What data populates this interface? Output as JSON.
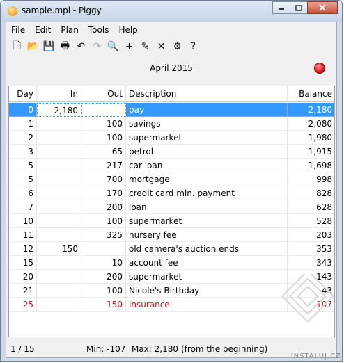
{
  "window": {
    "title": "sample.mpl - Piggy",
    "minimize_icon": "minimize-icon",
    "maximize_icon": "maximize-icon",
    "close_icon": "close-icon"
  },
  "menu": [
    "File",
    "Edit",
    "Plan",
    "Tools",
    "Help"
  ],
  "toolbar": [
    {
      "name": "new-icon",
      "glyph": "🗋",
      "enabled": true
    },
    {
      "name": "open-icon",
      "glyph": "📂",
      "enabled": true
    },
    {
      "name": "save-icon",
      "glyph": "💾",
      "enabled": true
    },
    {
      "name": "print-icon",
      "glyph": "🖶",
      "enabled": true
    },
    {
      "name": "undo-icon",
      "glyph": "↶",
      "enabled": true
    },
    {
      "name": "redo-icon",
      "glyph": "↷",
      "enabled": false
    },
    {
      "name": "search-icon",
      "glyph": "🔍",
      "enabled": true
    },
    {
      "name": "add-icon",
      "glyph": "+",
      "enabled": true
    },
    {
      "name": "edit-icon",
      "glyph": "✎",
      "enabled": true
    },
    {
      "name": "delete-icon",
      "glyph": "✕",
      "enabled": true
    },
    {
      "name": "settings-icon",
      "glyph": "⚙",
      "enabled": true
    },
    {
      "name": "help-icon",
      "glyph": "?",
      "enabled": true
    }
  ],
  "month": "April 2015",
  "status_indicator_color": "#e02020",
  "table": {
    "columns": [
      "Day",
      "In",
      "Out",
      "Description",
      "Balance"
    ],
    "rows": [
      {
        "day": "0",
        "in": "2,180",
        "out": "",
        "desc": "pay",
        "bal": "2,180",
        "selected": true,
        "negative": false
      },
      {
        "day": "1",
        "in": "",
        "out": "100",
        "desc": "savings",
        "bal": "2,080",
        "selected": false,
        "negative": false
      },
      {
        "day": "2",
        "in": "",
        "out": "100",
        "desc": "supermarket",
        "bal": "1,980",
        "selected": false,
        "negative": false
      },
      {
        "day": "3",
        "in": "",
        "out": "65",
        "desc": "petrol",
        "bal": "1,915",
        "selected": false,
        "negative": false
      },
      {
        "day": "5",
        "in": "",
        "out": "217",
        "desc": "car loan",
        "bal": "1,698",
        "selected": false,
        "negative": false
      },
      {
        "day": "5",
        "in": "",
        "out": "700",
        "desc": "mortgage",
        "bal": "998",
        "selected": false,
        "negative": false
      },
      {
        "day": "6",
        "in": "",
        "out": "170",
        "desc": "credit card min. payment",
        "bal": "828",
        "selected": false,
        "negative": false
      },
      {
        "day": "7",
        "in": "",
        "out": "200",
        "desc": "loan",
        "bal": "628",
        "selected": false,
        "negative": false
      },
      {
        "day": "10",
        "in": "",
        "out": "100",
        "desc": "supermarket",
        "bal": "528",
        "selected": false,
        "negative": false
      },
      {
        "day": "11",
        "in": "",
        "out": "325",
        "desc": "nursery fee",
        "bal": "203",
        "selected": false,
        "negative": false
      },
      {
        "day": "12",
        "in": "150",
        "out": "",
        "desc": "old camera's auction ends",
        "bal": "353",
        "selected": false,
        "negative": false
      },
      {
        "day": "15",
        "in": "",
        "out": "10",
        "desc": "account fee",
        "bal": "343",
        "selected": false,
        "negative": false
      },
      {
        "day": "20",
        "in": "",
        "out": "200",
        "desc": "supermarket",
        "bal": "143",
        "selected": false,
        "negative": false
      },
      {
        "day": "21",
        "in": "",
        "out": "100",
        "desc": "Nicole's Birthday",
        "bal": "43",
        "selected": false,
        "negative": false
      },
      {
        "day": "25",
        "in": "",
        "out": "150",
        "desc": "insurance",
        "bal": "-107",
        "selected": false,
        "negative": true
      }
    ]
  },
  "colors": {
    "selection": "#3399ff",
    "negative": "#d01020"
  },
  "status": {
    "count": "1 / 15",
    "min": "Min: -107",
    "max": "Max: 2,180",
    "note": "(from the beginning)"
  },
  "watermark": "INSTALUJ.CZ"
}
